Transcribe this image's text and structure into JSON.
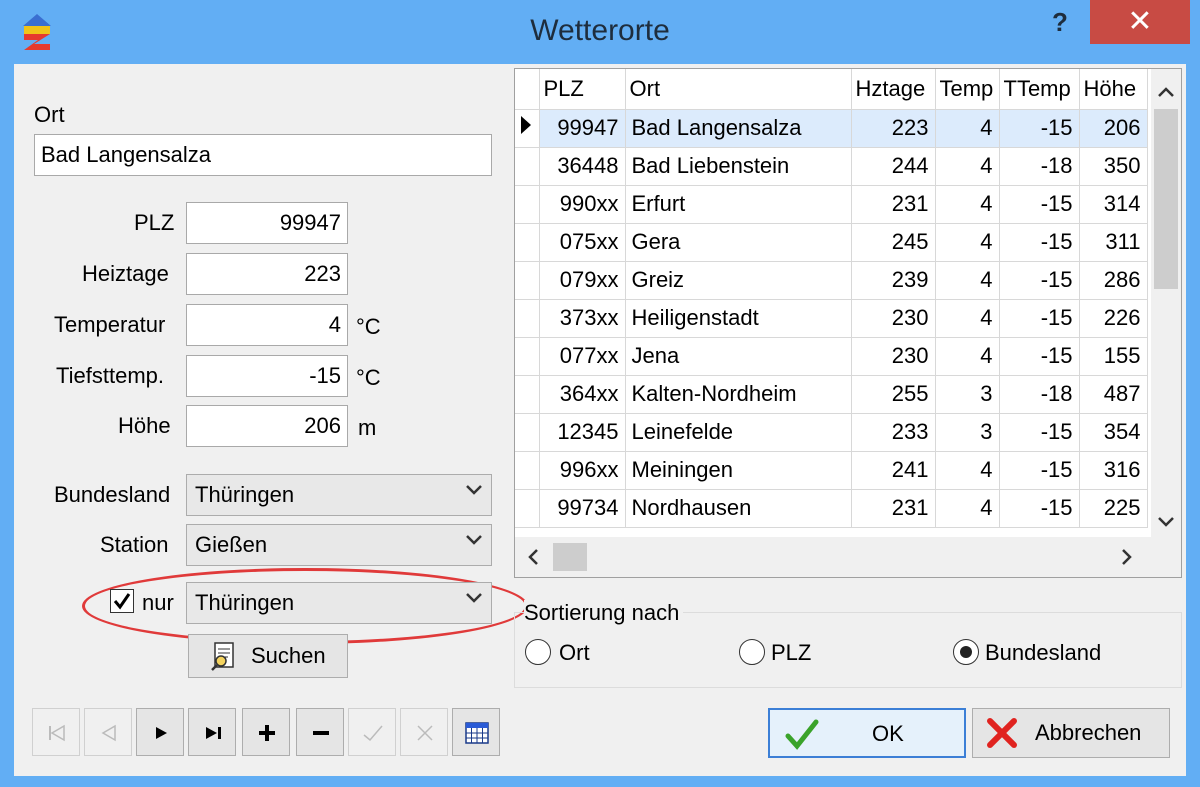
{
  "window": {
    "title": "Wetterorte",
    "help_label": "?",
    "close_label": "✕"
  },
  "form": {
    "ort_label": "Ort",
    "ort_value": "Bad Langensalza",
    "plz_label": "PLZ",
    "plz_value": "99947",
    "heiztage_label": "Heiztage",
    "heiztage_value": "223",
    "temperatur_label": "Temperatur",
    "temperatur_value": "4",
    "temperatur_unit": "°C",
    "tiefsttemp_label": "Tiefsttemp.",
    "tiefsttemp_value": "-15",
    "tiefsttemp_unit": "°C",
    "hoehe_label": "Höhe",
    "hoehe_value": "206",
    "hoehe_unit": "m",
    "bundesland_label": "Bundesland",
    "bundesland_value": "Thüringen",
    "station_label": "Station",
    "station_value": "Gießen",
    "filter_checked": true,
    "filter_label": "nur",
    "filter_value": "Thüringen",
    "search_label": "Suchen"
  },
  "grid": {
    "columns": [
      "PLZ",
      "Ort",
      "Hztage",
      "Temp",
      "TTemp",
      "Höhe"
    ],
    "rows": [
      [
        "99947",
        "Bad Langensalza",
        "223",
        "4",
        "-15",
        "206"
      ],
      [
        "36448",
        "Bad Liebenstein",
        "244",
        "4",
        "-18",
        "350"
      ],
      [
        "990xx",
        "Erfurt",
        "231",
        "4",
        "-15",
        "314"
      ],
      [
        "075xx",
        "Gera",
        "245",
        "4",
        "-15",
        "311"
      ],
      [
        "079xx",
        "Greiz",
        "239",
        "4",
        "-15",
        "286"
      ],
      [
        "373xx",
        "Heiligenstadt",
        "230",
        "4",
        "-15",
        "226"
      ],
      [
        "077xx",
        "Jena",
        "230",
        "4",
        "-15",
        "155"
      ],
      [
        "364xx",
        "Kalten-Nordheim",
        "255",
        "3",
        "-18",
        "487"
      ],
      [
        "12345",
        "Leinefelde",
        "233",
        "3",
        "-15",
        "354"
      ],
      [
        "996xx",
        "Meiningen",
        "241",
        "4",
        "-15",
        "316"
      ],
      [
        "99734",
        "Nordhausen",
        "231",
        "4",
        "-15",
        "225"
      ]
    ],
    "selected_row": 0
  },
  "sort": {
    "label": "Sortierung nach",
    "options": [
      "Ort",
      "PLZ",
      "Bundesland"
    ],
    "selected": "Bundesland"
  },
  "buttons": {
    "ok_label": "OK",
    "cancel_label": "Abbrechen"
  },
  "colors": {
    "titlebar": "#62aef4",
    "close": "#c84b44",
    "highlight": "#e03a3a",
    "selection": "#dcebfc"
  }
}
